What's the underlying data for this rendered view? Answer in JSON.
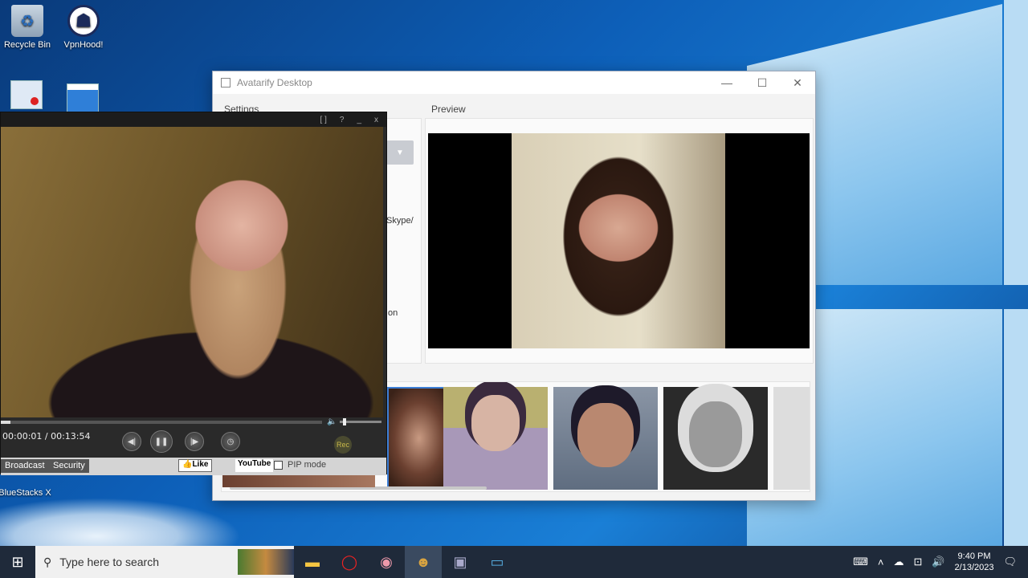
{
  "desktop": {
    "icons": [
      {
        "label": "Recycle Bin"
      },
      {
        "label": "VpnHood!"
      },
      {
        "label": "BlueStacks X"
      }
    ]
  },
  "avatarify": {
    "title": "Avatarify Desktop",
    "settings_label": "Settings",
    "preview_label": "Preview",
    "partial_skype": "Skype/",
    "partial_on": "on"
  },
  "player": {
    "time": "00:00:01 / 00:13:54",
    "rec_label": "Rec",
    "tabs": [
      "Broadcast",
      "Security"
    ],
    "like_label": "Like",
    "youtube_label": "YouTube",
    "pip_label": "PIP mode",
    "top_controls": [
      "[ ]",
      "?",
      "_",
      "x"
    ]
  },
  "taskbar": {
    "search_placeholder": "Type here to search",
    "time": "9:40 PM",
    "date": "2/13/2023"
  },
  "colors": {
    "accent": "#3d7fd6",
    "taskbar": "#1f2a3a"
  }
}
